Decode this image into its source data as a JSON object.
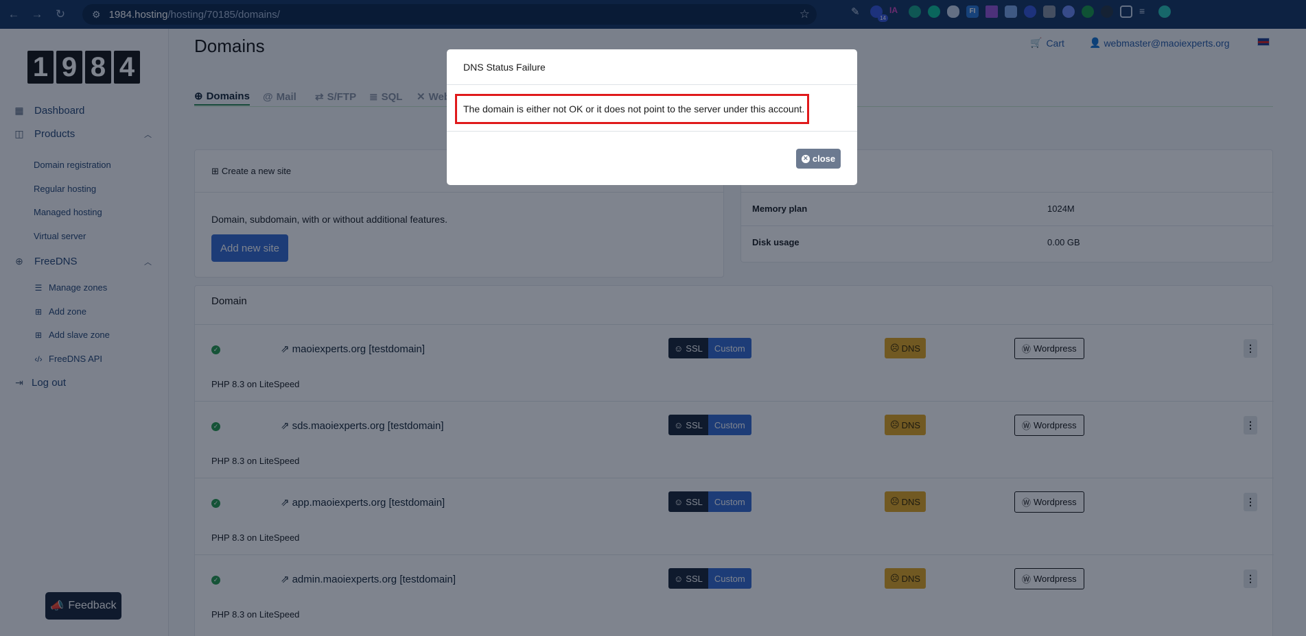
{
  "browser": {
    "url_host": "1984.hosting",
    "url_path": "/hosting/70185/domains/",
    "extension_badge": "14",
    "extension_ia": "IA",
    "extension_fi": "FI"
  },
  "logo": [
    "1",
    "9",
    "8",
    "4"
  ],
  "sidebar": {
    "dashboard": "Dashboard",
    "products": "Products",
    "products_items": [
      "Domain registration",
      "Regular hosting",
      "Managed hosting",
      "Virtual server"
    ],
    "freedns": "FreeDNS",
    "freedns_items": [
      "Manage zones",
      "Add zone",
      "Add slave zone",
      "FreeDNS API"
    ],
    "logout": "Log out",
    "feedback": "Feedback"
  },
  "header": {
    "title": "Domains",
    "cart": "Cart",
    "user": "webmaster@maoiexperts.org"
  },
  "tabs": [
    "Domains",
    "Mail",
    "S/FTP",
    "SQL",
    "Web"
  ],
  "create_card": {
    "header": "Create a new site",
    "description": "Domain, subdomain, with or without additional features.",
    "button": "Add new site"
  },
  "info_card": {
    "rows": [
      {
        "key": "Memory plan",
        "value": "1024M"
      },
      {
        "key": "Disk usage",
        "value": "0.00 GB"
      }
    ]
  },
  "domain_table": {
    "header": "Domain",
    "ssl_label": "SSL",
    "custom_label": "Custom",
    "dns_label": "DNS",
    "wordpress_label": "Wordpress",
    "rows": [
      {
        "name": "maoiexperts.org [testdomain]",
        "php": "PHP 8.3 on LiteSpeed"
      },
      {
        "name": "sds.maoiexperts.org [testdomain]",
        "php": "PHP 8.3 on LiteSpeed"
      },
      {
        "name": "app.maoiexperts.org [testdomain]",
        "php": "PHP 8.3 on LiteSpeed"
      },
      {
        "name": "admin.maoiexperts.org [testdomain]",
        "php": "PHP 8.3 on LiteSpeed"
      }
    ]
  },
  "modal": {
    "title": "DNS Status Failure",
    "message": "The domain is either not OK or it does not point to the server under this account.",
    "close": "close"
  },
  "colors": {
    "chrome": "#1b3a66",
    "primary": "#3b6fd0",
    "dark": "#1e2b3c",
    "warning": "#e3a826",
    "success": "#2a9d50",
    "highlight": "#e0191b"
  }
}
